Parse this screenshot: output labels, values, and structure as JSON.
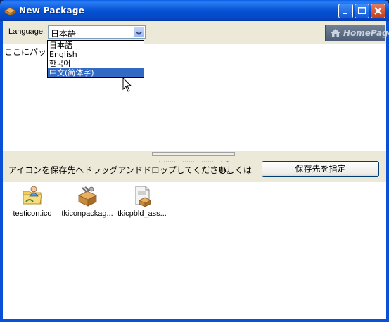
{
  "window": {
    "title": "New Package",
    "app_icon": "package-icon"
  },
  "titlebar_buttons": [
    "minimize-icon",
    "maximize-icon",
    "close-icon"
  ],
  "toolbar": {
    "language_label": "Language:",
    "language_value": "日本語",
    "homepage_label": "HomePage"
  },
  "language_options": [
    "日本語",
    "English",
    "한국어",
    "中文(简体字)"
  ],
  "language_highlighted": "中文(简体字)",
  "upper_pane": {
    "text": "ここにパッケ"
  },
  "drop_bar": {
    "instruction": "アイコンを保存先へドラッグアンドドロップしてください。",
    "or_label": "もしくは",
    "save_button": "保存先を指定"
  },
  "files": [
    {
      "name": "testicon.ico",
      "icon": "folder-person-icon"
    },
    {
      "name": "tkiconpackag...",
      "icon": "package-tools-icon"
    },
    {
      "name": "tkicpbld_ass...",
      "icon": "document-package-icon"
    }
  ],
  "colors": {
    "titlebar": "#0A58D8",
    "selection": "#316AC5",
    "face": "#ECE9D8"
  }
}
